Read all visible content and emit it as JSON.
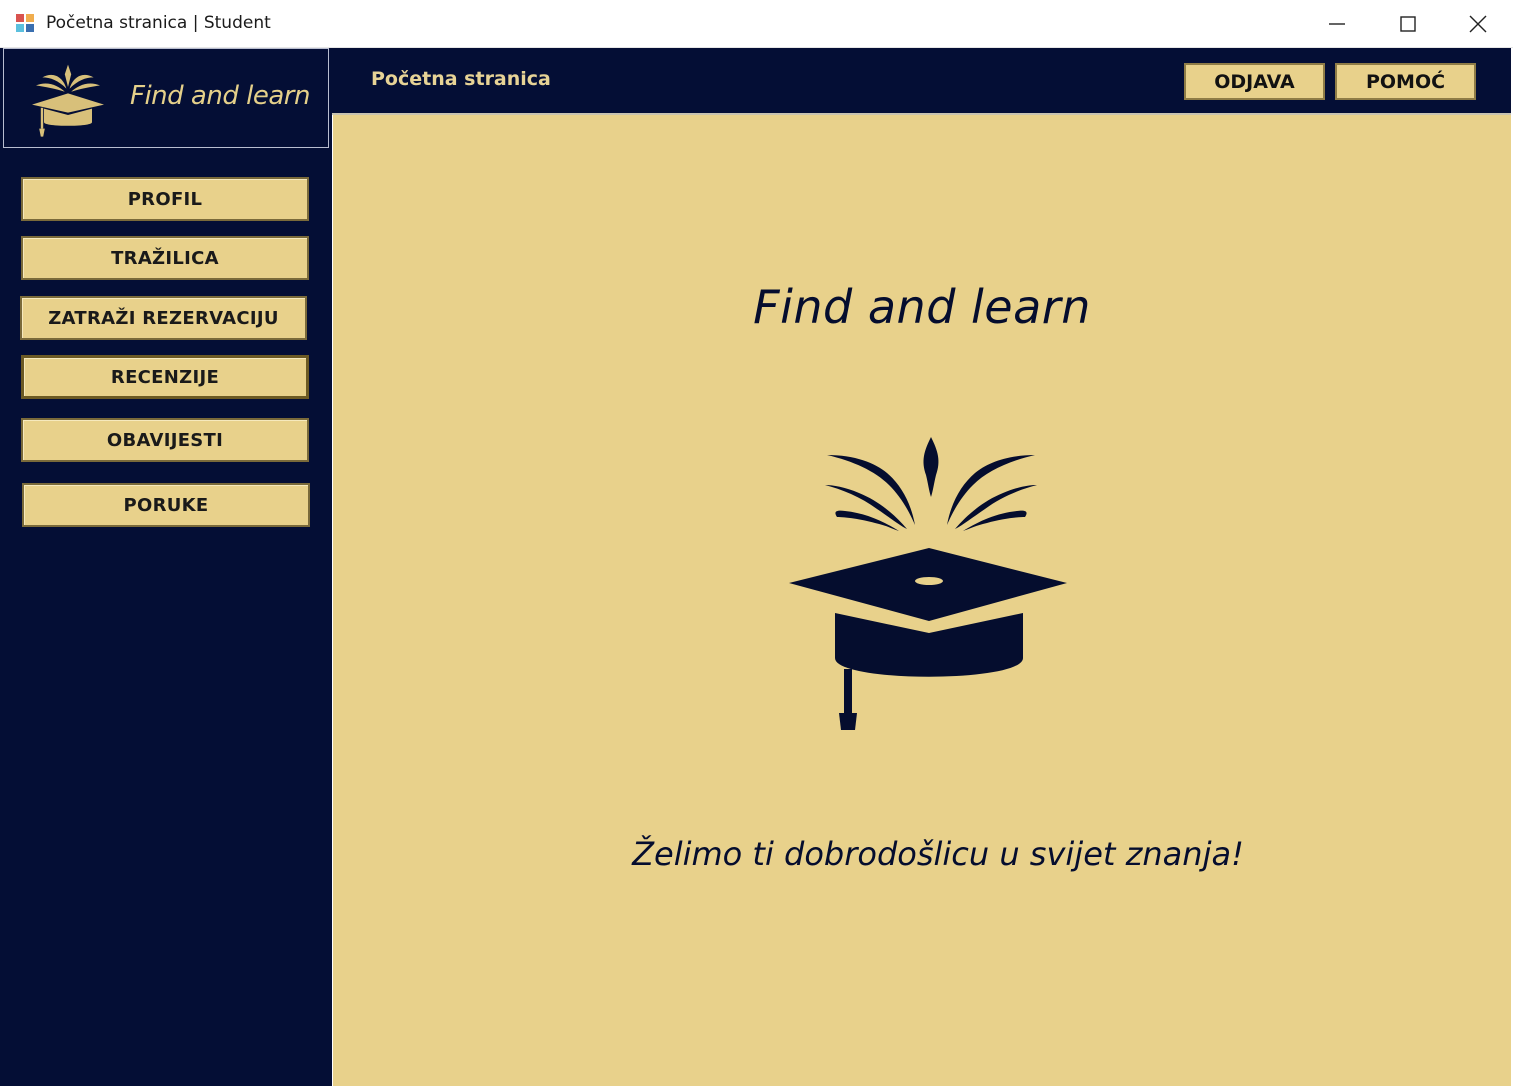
{
  "window": {
    "title": "Početna stranica | Student",
    "controls": {
      "minimize": "minimize-icon",
      "maximize": "maximize-icon",
      "close": "close-icon"
    }
  },
  "brand": {
    "name": "Find and learn",
    "icon": "graduation-cap-icon"
  },
  "header": {
    "title": "Početna stranica",
    "logout_label": "ODJAVA",
    "help_label": "POMOĆ"
  },
  "sidebar": {
    "items": [
      {
        "label": "PROFIL"
      },
      {
        "label": "TRAŽILICA"
      },
      {
        "label": "ZATRAŽI REZERVACIJU"
      },
      {
        "label": "RECENZIJE"
      },
      {
        "label": "OBAVIJESTI"
      },
      {
        "label": "PORUKE"
      }
    ]
  },
  "main": {
    "title": "Find and learn",
    "welcome": "Želimo ti dobrodošlicu u svijet znanja!"
  },
  "colors": {
    "navy": "#040e35",
    "gold": "#e8d18b",
    "gold_text": "#e5d08a"
  }
}
